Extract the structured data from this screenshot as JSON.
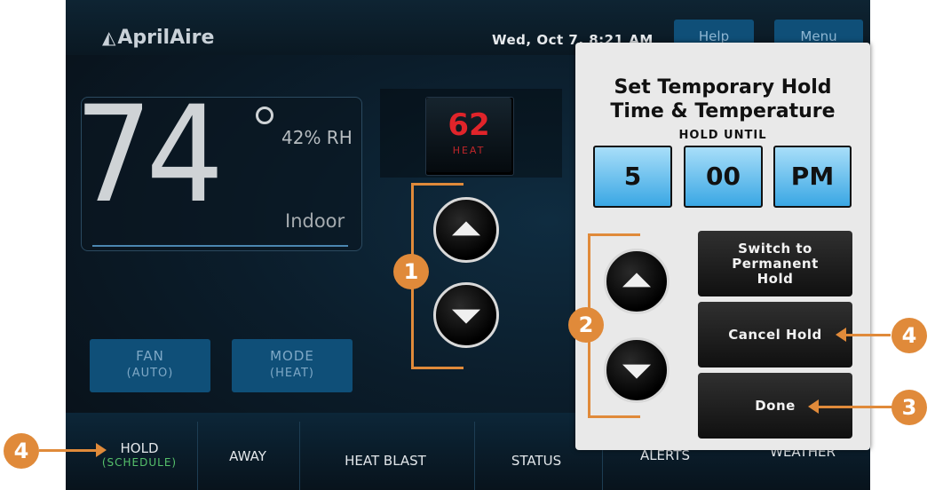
{
  "header": {
    "brand": "AprilAire",
    "datetime": "Wed, Oct 7, 8:21 AM",
    "help_label": "Help",
    "menu_label": "Menu"
  },
  "indoor": {
    "temperature": "74",
    "humidity": "42% RH",
    "label": "Indoor"
  },
  "setpoint": {
    "value": "62",
    "mode": "HEAT"
  },
  "controls": {
    "fan_label": "FAN",
    "fan_value": "(AUTO)",
    "mode_label": "MODE",
    "mode_value": "(HEAT)"
  },
  "nav": {
    "hold_label": "HOLD",
    "hold_sub": "(SCHEDULE)",
    "away_label": "AWAY",
    "heat_blast_label": "HEAT BLAST",
    "status_label": "STATUS",
    "alerts_label": "ALERTS",
    "weather_label": "WEATHER"
  },
  "dialog": {
    "title_line1": "Set Temporary Hold",
    "title_line2": "Time & Temperature",
    "hold_until": "HOLD UNTIL",
    "hour": "5",
    "minute": "00",
    "ampm": "PM",
    "switch_line1": "Switch to",
    "switch_line2": "Permanent",
    "switch_line3": "Hold",
    "cancel_label": "Cancel Hold",
    "done_label": "Done"
  },
  "callouts": {
    "one": "1",
    "two": "2",
    "three": "3",
    "four_right": "4",
    "four_left": "4"
  },
  "colors": {
    "accent_orange": "#e08a3a",
    "time_blue": "#3aa7e4",
    "setpoint_red": "#e0242a",
    "hold_green": "#56c16b"
  }
}
